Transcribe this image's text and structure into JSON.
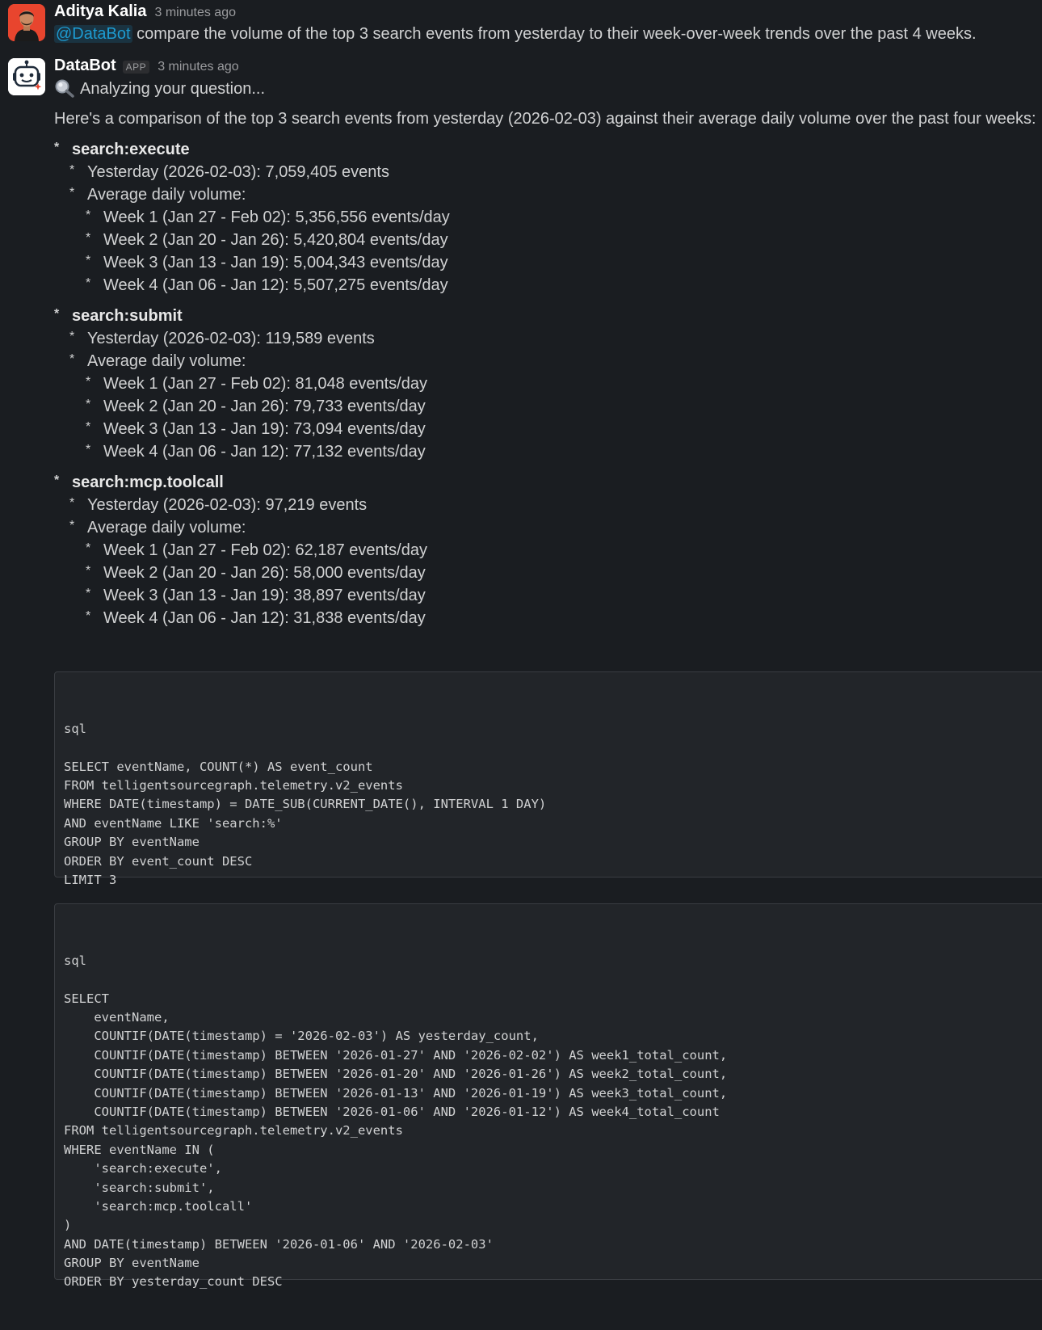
{
  "user_message": {
    "author": "Aditya Kalia",
    "timestamp": "3 minutes ago",
    "mention": "@DataBot",
    "text": " compare the volume of the top 3 search events from yesterday to their week-over-week trends over the past 4 weeks."
  },
  "bot_message": {
    "author": "DataBot",
    "badge": "APP",
    "timestamp": "3 minutes ago",
    "status": "Analyzing your question...",
    "intro": "Here's a comparison of the top 3 search events from yesterday (2026-02-03) against their average daily volume over the past four weeks:",
    "events": [
      {
        "name": "search:execute",
        "yesterday": "Yesterday (2026-02-03): 7,059,405 events",
        "avg_label": "Average daily volume:",
        "weeks": [
          "Week 1 (Jan 27 - Feb 02): 5,356,556 events/day",
          "Week 2 (Jan 20 - Jan 26): 5,420,804 events/day",
          "Week 3 (Jan 13 - Jan 19): 5,004,343 events/day",
          "Week 4 (Jan 06 - Jan 12): 5,507,275 events/day"
        ]
      },
      {
        "name": "search:submit",
        "yesterday": "Yesterday (2026-02-03): 119,589 events",
        "avg_label": "Average daily volume:",
        "weeks": [
          "Week 1 (Jan 27 - Feb 02): 81,048 events/day",
          "Week 2 (Jan 20 - Jan 26): 79,733 events/day",
          "Week 3 (Jan 13 - Jan 19): 73,094 events/day",
          "Week 4 (Jan 06 - Jan 12): 77,132 events/day"
        ]
      },
      {
        "name": "search:mcp.toolcall",
        "yesterday": "Yesterday (2026-02-03): 97,219 events",
        "avg_label": "Average daily volume:",
        "weeks": [
          "Week 1 (Jan 27 - Feb 02): 62,187 events/day",
          "Week 2 (Jan 20 - Jan 26): 58,000 events/day",
          "Week 3 (Jan 13 - Jan 19): 38,897 events/day",
          "Week 4 (Jan 06 - Jan 12): 31,838 events/day"
        ]
      }
    ],
    "code_blocks": [
      {
        "lines": [
          "sql",
          "",
          "SELECT eventName, COUNT(*) AS event_count",
          "FROM telligentsourcegraph.telemetry.v2_events",
          "WHERE DATE(timestamp) = DATE_SUB(CURRENT_DATE(), INTERVAL 1 DAY)",
          "AND eventName LIKE 'search:%'",
          "GROUP BY eventName",
          "ORDER BY event_count DESC",
          "LIMIT 3"
        ]
      },
      {
        "lines": [
          "sql",
          "",
          "SELECT",
          "    eventName,",
          "    COUNTIF(DATE(timestamp) = '2026-02-03') AS yesterday_count,",
          "    COUNTIF(DATE(timestamp) BETWEEN '2026-01-27' AND '2026-02-02') AS week1_total_count,",
          "    COUNTIF(DATE(timestamp) BETWEEN '2026-01-20' AND '2026-01-26') AS week2_total_count,",
          "    COUNTIF(DATE(timestamp) BETWEEN '2026-01-13' AND '2026-01-19') AS week3_total_count,",
          "    COUNTIF(DATE(timestamp) BETWEEN '2026-01-06' AND '2026-01-12') AS week4_total_count",
          "FROM telligentsourcegraph.telemetry.v2_events",
          "WHERE eventName IN (",
          "    'search:execute',",
          "    'search:submit',",
          "    'search:mcp.toolcall'",
          ")",
          "AND DATE(timestamp) BETWEEN '2026-01-06' AND '2026-02-03'",
          "GROUP BY eventName",
          "ORDER BY yesterday_count DESC"
        ]
      }
    ]
  }
}
